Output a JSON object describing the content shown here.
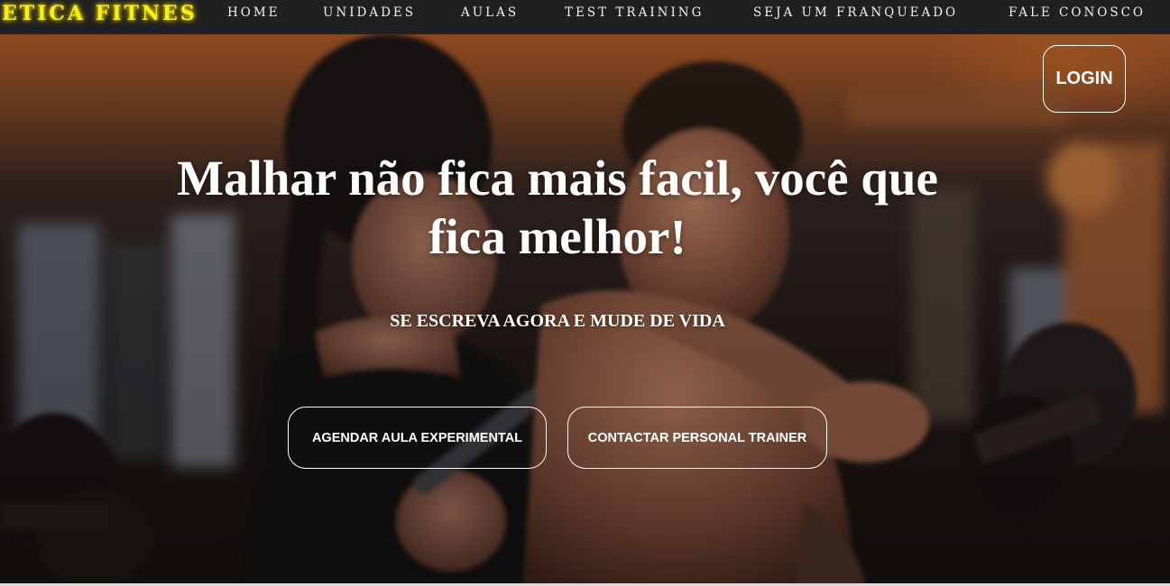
{
  "brand": {
    "name": "ETICA FITNES",
    "color": "#f4f01a"
  },
  "nav": {
    "items": [
      {
        "label": "HOME"
      },
      {
        "label": "UNIDADES"
      },
      {
        "label": "AULAS"
      },
      {
        "label": "TEST TRAINING"
      },
      {
        "label": "SEJA UM FRANQUEADO"
      },
      {
        "label": "FALE CONOSCO"
      }
    ]
  },
  "hero": {
    "login_label": "LOGIN",
    "headline": "Malhar não fica mais facil, você que fica melhor!",
    "subtitle": "SE ESCREVA AGORA E MUDE DE VIDA",
    "buttons": [
      {
        "label": "AGENDAR AULA EXPERIMENTAL"
      },
      {
        "label": "CONTACTAR PERSONAL TRAINER"
      }
    ],
    "background": "photo of a woman and a man lifting dumbbells in a gym"
  },
  "colors": {
    "navbar_bg": "#202020",
    "text": "#ffffff",
    "accent": "#f4f01a"
  }
}
